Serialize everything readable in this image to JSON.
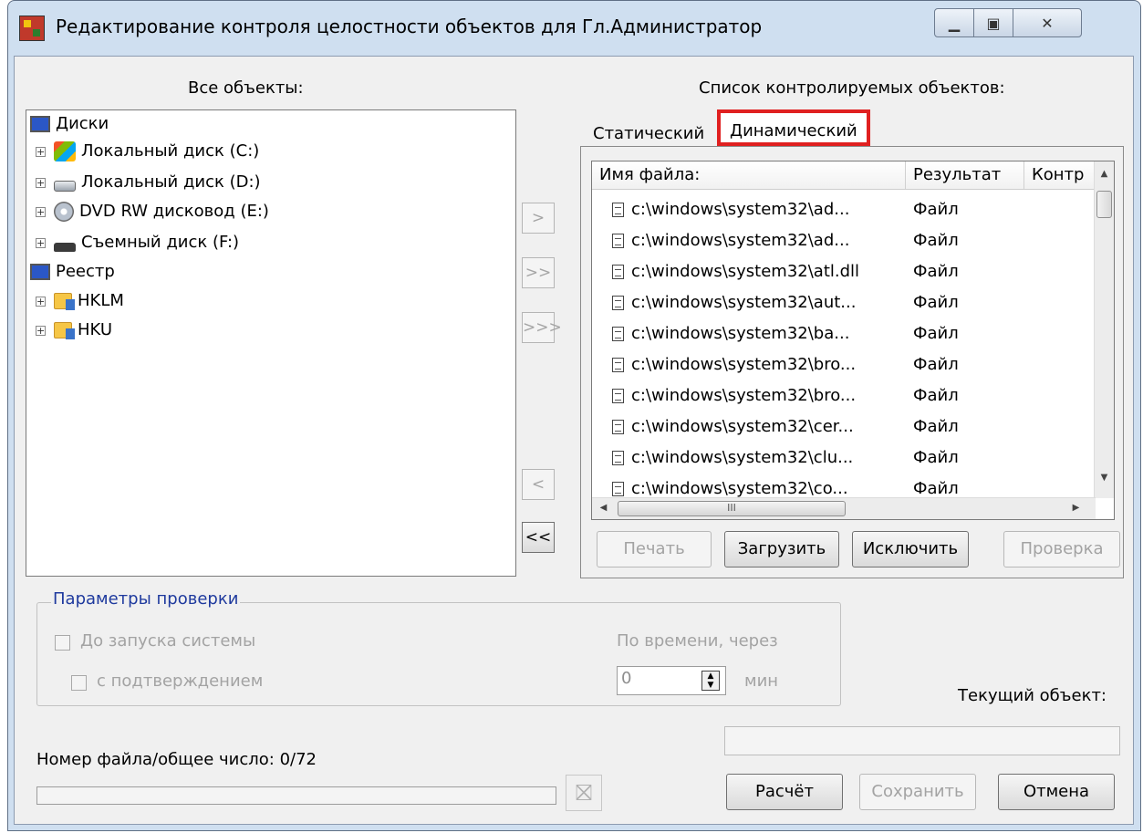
{
  "window": {
    "title": "Редактирование контроля целостности объектов для Гл.Администратор"
  },
  "left": {
    "label": "Все объекты:",
    "tree": [
      {
        "label": "Диски",
        "icon": "monitor-icon"
      },
      {
        "label": "Локальный диск (C:)",
        "icon": "windows-drive-icon"
      },
      {
        "label": "Локальный диск (D:)",
        "icon": "hard-drive-icon"
      },
      {
        "label": "DVD RW дисковод (E:)",
        "icon": "dvd-drive-icon"
      },
      {
        "label": "Съемный диск (F:)",
        "icon": "removable-drive-icon"
      },
      {
        "label": "Реестр",
        "icon": "monitor-icon"
      },
      {
        "label": "HKLM",
        "icon": "registry-folder-icon"
      },
      {
        "label": "HKU",
        "icon": "registry-folder-icon"
      }
    ],
    "expander_symbol": "+"
  },
  "transfer_buttons": [
    ">",
    ">>",
    ">>>",
    "<",
    "<<"
  ],
  "right": {
    "label": "Список контролируемых объектов:",
    "tabs": [
      "Статический",
      "Динамический"
    ],
    "active_tab": "Динамический",
    "columns": [
      "Имя файла:",
      "Результат",
      "Контр"
    ],
    "rows": [
      {
        "name": "c:\\windows\\system32\\ad...",
        "result": "Файл"
      },
      {
        "name": "c:\\windows\\system32\\ad...",
        "result": "Файл"
      },
      {
        "name": "c:\\windows\\system32\\atl.dll",
        "result": "Файл"
      },
      {
        "name": "c:\\windows\\system32\\aut...",
        "result": "Файл"
      },
      {
        "name": "c:\\windows\\system32\\ba...",
        "result": "Файл"
      },
      {
        "name": "c:\\windows\\system32\\bro...",
        "result": "Файл"
      },
      {
        "name": "c:\\windows\\system32\\bro...",
        "result": "Файл"
      },
      {
        "name": "c:\\windows\\system32\\cer...",
        "result": "Файл"
      },
      {
        "name": "c:\\windows\\system32\\clu...",
        "result": "Файл"
      },
      {
        "name": "c:\\windows\\system32\\co...",
        "result": "Файл"
      }
    ],
    "scroll_glyph": "III",
    "buttons": {
      "print": "Печать",
      "load": "Загрузить",
      "exclude": "Исключить",
      "check": "Проверка"
    }
  },
  "params": {
    "title": "Параметры проверки",
    "before_start": "До запуска системы",
    "with_confirm": "с подтверждением",
    "by_time": "По времени, через",
    "minutes_value": "0",
    "minutes_unit": "мин"
  },
  "current_object_label": "Текущий объект:",
  "file_counter_label": "Номер файла/общее число:",
  "file_counter_value": "0/72",
  "bottom_buttons": {
    "calc": "Расчёт",
    "save": "Сохранить",
    "cancel": "Отмена"
  }
}
